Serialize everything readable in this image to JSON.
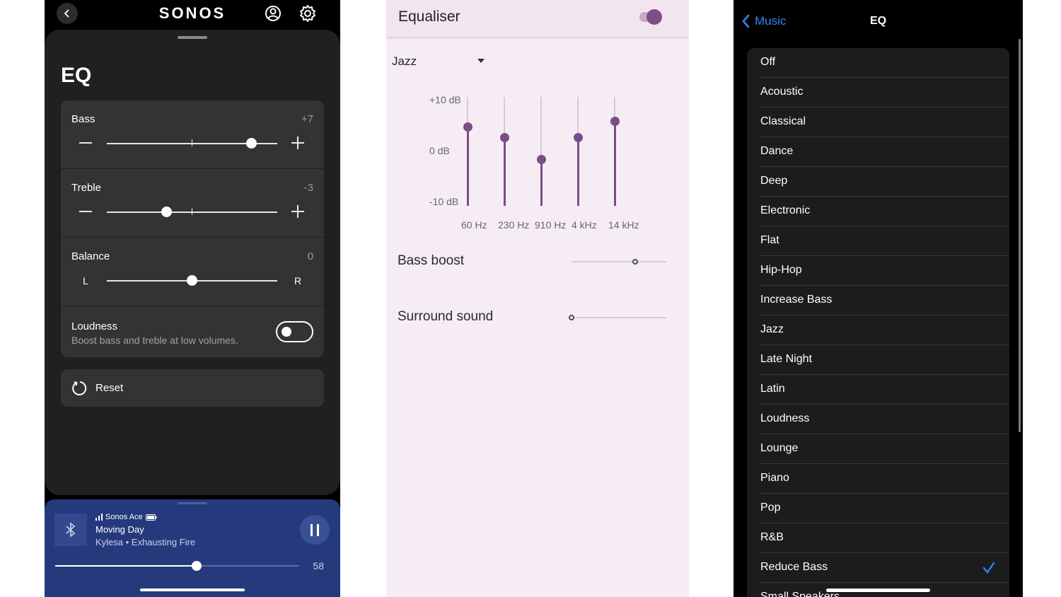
{
  "sonos": {
    "brand": "SONOS",
    "title": "EQ",
    "bass": {
      "label": "Bass",
      "value": "+7",
      "level": 7
    },
    "treble": {
      "label": "Treble",
      "value": "-3",
      "level": -3
    },
    "balance": {
      "label": "Balance",
      "value": "0",
      "level": 0,
      "left_label": "L",
      "right_label": "R"
    },
    "loudness": {
      "label": "Loudness",
      "subtitle": "Boost bass and treble at low volumes.",
      "enabled": false
    },
    "reset_label": "Reset",
    "player": {
      "device": "Sonos Ace",
      "track": "Moving Day",
      "artist_album": "Kylesa • Exhausting Fire",
      "volume": "58",
      "volume_fraction": 0.58
    }
  },
  "android": {
    "title": "Equaliser",
    "enabled": true,
    "preset": "Jazz",
    "db_labels": [
      "+10 dB",
      "0 dB",
      "-10 dB"
    ],
    "bands": [
      {
        "freq": "60 Hz",
        "level_db": 4.5
      },
      {
        "freq": "230 Hz",
        "level_db": 2.5
      },
      {
        "freq": "910 Hz",
        "level_db": -1.5
      },
      {
        "freq": "4 kHz",
        "level_db": 2.5
      },
      {
        "freq": "14 kHz",
        "level_db": 5.5
      }
    ],
    "bass_boost": {
      "label": "Bass boost",
      "fraction": 0.67
    },
    "surround": {
      "label": "Surround sound",
      "fraction": 0.0
    }
  },
  "ios": {
    "back_label": "Music",
    "title": "EQ",
    "selected": "Reduce Bass",
    "items": [
      "Off",
      "Acoustic",
      "Classical",
      "Dance",
      "Deep",
      "Electronic",
      "Flat",
      "Hip-Hop",
      "Increase Bass",
      "Jazz",
      "Late Night",
      "Latin",
      "Loudness",
      "Lounge",
      "Piano",
      "Pop",
      "R&B",
      "Reduce Bass",
      "Small Speakers"
    ]
  },
  "colors": {
    "sonos_player_bg": "#253a7c",
    "android_accent": "#7a4c88",
    "ios_accent": "#2f86f6"
  }
}
